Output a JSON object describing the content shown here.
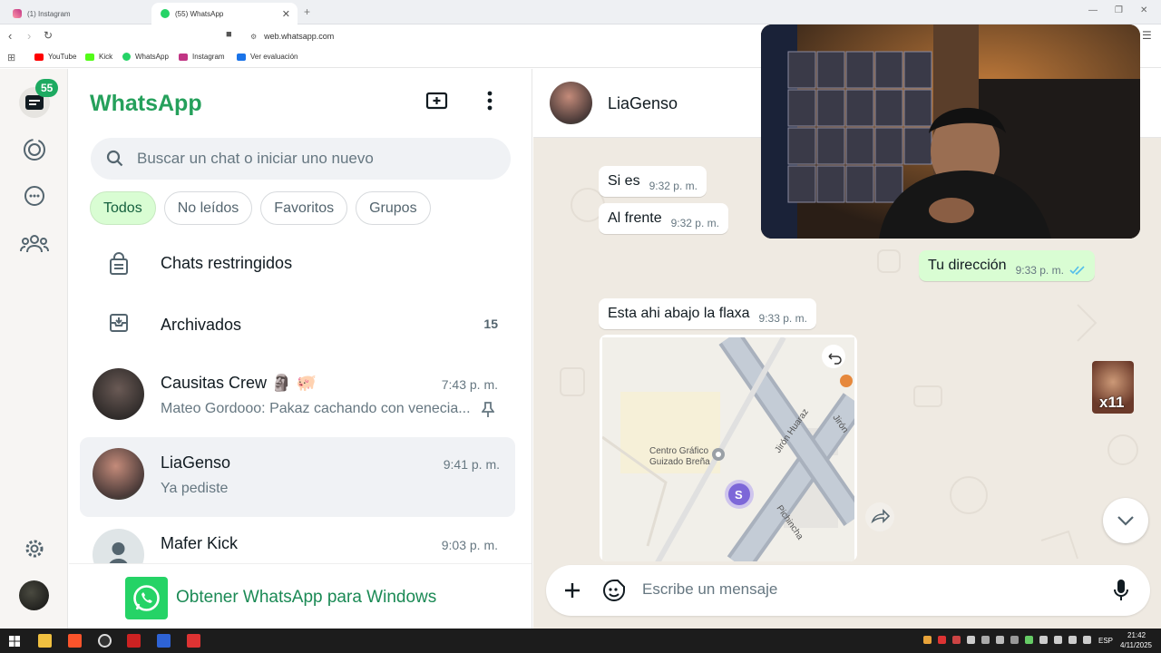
{
  "browser": {
    "tabs": [
      {
        "label": "(1) Instagram",
        "active": false
      },
      {
        "label": "(55) WhatsApp",
        "active": true
      }
    ],
    "url": "web.whatsapp.com",
    "bookmarks": [
      "YouTube",
      "Kick",
      "WhatsApp",
      "Instagram",
      "Ver evaluación"
    ]
  },
  "rail": {
    "unread_badge": "55"
  },
  "sidebar": {
    "title": "WhatsApp",
    "search_placeholder": "Buscar un chat o iniciar uno nuevo",
    "filters": [
      "Todos",
      "No leídos",
      "Favoritos",
      "Grupos"
    ],
    "active_filter": "Todos",
    "restricted_label": "Chats restringidos",
    "archived_label": "Archivados",
    "archived_count": "15",
    "chats": [
      {
        "name": "Causitas Crew 🗿 🐖",
        "time": "7:43 p. m.",
        "preview": "Mateo Gordooo: Pakaz cachando con venecia...",
        "pinned": true
      },
      {
        "name": "LiaGenso",
        "time": "9:41 p. m.",
        "preview": "Ya pediste",
        "selected": true
      },
      {
        "name": "Mafer Kick",
        "time": "9:03 p. m.",
        "preview": ""
      }
    ],
    "get_app_label": "Obtener WhatsApp para Windows"
  },
  "conversation": {
    "contact_name": "LiaGenso",
    "messages": [
      {
        "text": "Si es",
        "time": "9:32 p. m.",
        "direction": "in"
      },
      {
        "text": "Al frente",
        "time": "9:32 p. m.",
        "direction": "in"
      },
      {
        "text": "Tu dirección",
        "time": "9:33 p. m.",
        "direction": "out",
        "status": "read"
      },
      {
        "text": "Esta ahi abajo la flaxa",
        "time": "9:33 p. m.",
        "direction": "in"
      }
    ],
    "map": {
      "place_label_line1": "Centro Gráfico",
      "place_label_line2": "Guizado Breña",
      "street1": "Jirón Huaraz",
      "street2": "Jirón",
      "street3": "Pichincha",
      "pin_letter": "S"
    },
    "composer_placeholder": "Escribe un mensaje",
    "overlay_sticker_text": "x11"
  },
  "taskbar": {
    "language": "ESP",
    "time": "21:42",
    "date": "4/11/2025"
  },
  "colors": {
    "brand_green": "#25a05b",
    "badge_green": "#1daa61",
    "outgoing_bubble": "#d9fdd3",
    "chat_background": "#efeae2"
  }
}
